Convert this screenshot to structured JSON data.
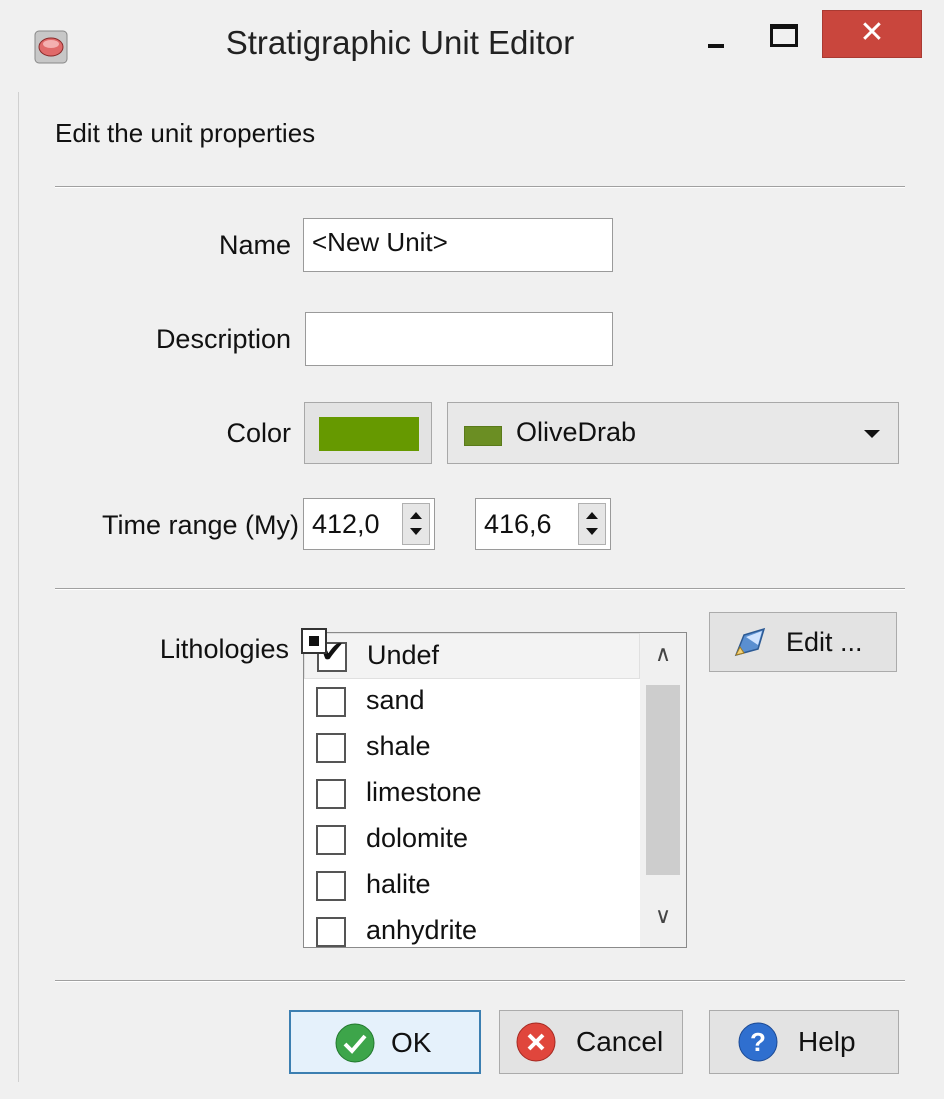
{
  "window": {
    "title": "Stratigraphic Unit Editor",
    "close_glyph": "✕"
  },
  "header": {
    "subtitle": "Edit the unit properties"
  },
  "form": {
    "name_label": "Name",
    "name_value": "<New Unit>",
    "description_label": "Description",
    "description_value": "",
    "color_label": "Color",
    "color_hex": "#669900",
    "color_combo_value": "OliveDrab",
    "color_combo_swatch": "#6b8e23",
    "time_range_label": "Time range (My)",
    "time_start": "412,0",
    "time_end": "416,6",
    "lithologies_label": "Lithologies",
    "edit_button_label": "Edit ..."
  },
  "lithologies": [
    {
      "label": "Undef",
      "checked": true
    },
    {
      "label": "sand",
      "checked": false
    },
    {
      "label": "shale",
      "checked": false
    },
    {
      "label": "limestone",
      "checked": false
    },
    {
      "label": "dolomite",
      "checked": false
    },
    {
      "label": "halite",
      "checked": false
    },
    {
      "label": "anhydrite",
      "checked": false
    }
  ],
  "buttons": {
    "ok": "OK",
    "cancel": "Cancel",
    "help": "Help"
  },
  "icons": {
    "app": "app-icon",
    "edit": "edit-pencil-icon",
    "ok": "ok-check-icon",
    "cancel": "cancel-x-icon",
    "help": "help-question-icon"
  }
}
